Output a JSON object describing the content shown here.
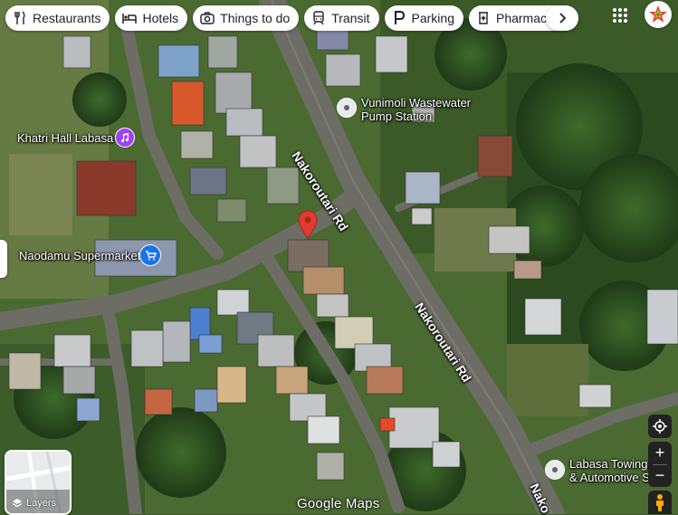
{
  "categories": [
    {
      "label": "Restaurants",
      "icon": "fork-knife-icon"
    },
    {
      "label": "Hotels",
      "icon": "bed-icon"
    },
    {
      "label": "Things to do",
      "icon": "camera-icon"
    },
    {
      "label": "Transit",
      "icon": "train-icon"
    },
    {
      "label": "Parking",
      "icon": "parking-icon"
    },
    {
      "label": "Pharmacies",
      "icon": "pharmacy-icon"
    }
  ],
  "places": {
    "khatri_hall": "Khatri Hall Labasa",
    "supermarket": "Naodamu Supermarket",
    "wastewater_line1": "Vunimoli Wastewater",
    "wastewater_line2": "Pump Station",
    "towing_line1": "Labasa Towing",
    "towing_line2": "& Automotive Se"
  },
  "roads": {
    "upper": "Nakoroutari Rd",
    "middle": "Nakoroutari Rd",
    "lower": "Nako"
  },
  "controls": {
    "layers_label": "Layers",
    "zoom_in": "+",
    "zoom_out": "−"
  },
  "branding": "Google Maps",
  "colors": {
    "pin_red": "#e53935",
    "khatri_pin": "#a142f4",
    "supermarket_pin": "#1a73e8",
    "place_pin": "#e8eaed"
  }
}
